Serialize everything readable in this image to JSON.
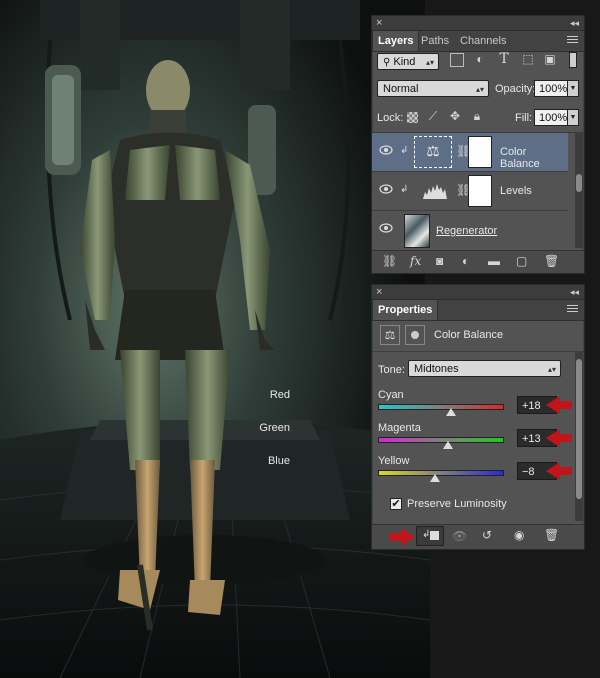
{
  "layers_panel": {
    "tabs": [
      {
        "label": "Layers"
      },
      {
        "label": "Paths"
      },
      {
        "label": "Channels"
      }
    ],
    "filter_kind": "Kind",
    "blend_mode": "Normal",
    "opacity_label": "Opacity:",
    "opacity_value": "100%",
    "lock_label": "Lock:",
    "fill_label": "Fill:",
    "fill_value": "100%",
    "layers": [
      {
        "name": "Color Balance",
        "selected": true
      },
      {
        "name": "Levels",
        "selected": false
      },
      {
        "name": "Regenerator",
        "selected": false
      }
    ],
    "footer_icons": [
      "link-icon",
      "fx-icon",
      "mask-icon",
      "adjustment-icon",
      "folder-icon",
      "new-layer-icon",
      "trash-icon"
    ]
  },
  "properties_panel": {
    "tab": "Properties",
    "adjustment_title": "Color Balance",
    "tone_label": "Tone:",
    "tone_value": "Midtones",
    "sliders": [
      {
        "left": "Cyan",
        "right": "Red",
        "value": 18,
        "display": "+18",
        "track": "cyan-red"
      },
      {
        "left": "Magenta",
        "right": "Green",
        "value": 13,
        "display": "+13",
        "track": "magenta-green"
      },
      {
        "left": "Yellow",
        "right": "Blue",
        "value": -8,
        "display": "−8",
        "track": "yellow-blue"
      }
    ],
    "slider_range": [
      -100,
      100
    ],
    "preserve_luminosity_label": "Preserve Luminosity",
    "preserve_luminosity_checked": true,
    "accent_arrow_color": "#c0161b"
  }
}
